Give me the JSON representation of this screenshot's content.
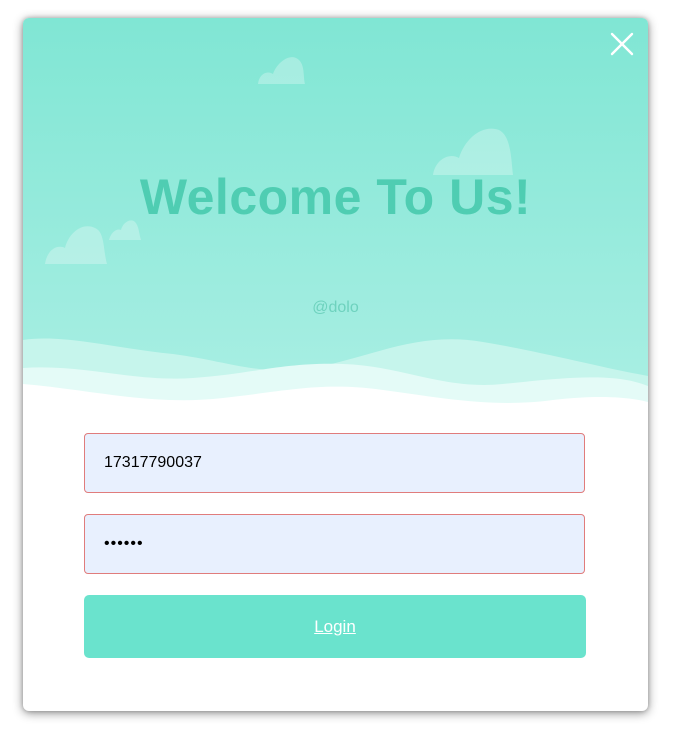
{
  "header": {
    "title": "Welcome To Us!",
    "subtitle": "@dolo"
  },
  "form": {
    "username_value": "17317790037",
    "password_value": "123456",
    "login_label": "Login"
  },
  "icons": {
    "close": "close-icon"
  },
  "colors": {
    "banner_top": "#80e6d4",
    "banner_bottom": "#a8efe3",
    "title": "#4fcdb2",
    "login_button": "#6ae3cd",
    "input_bg": "#e8f0fe",
    "input_border": "#e07c7c"
  }
}
